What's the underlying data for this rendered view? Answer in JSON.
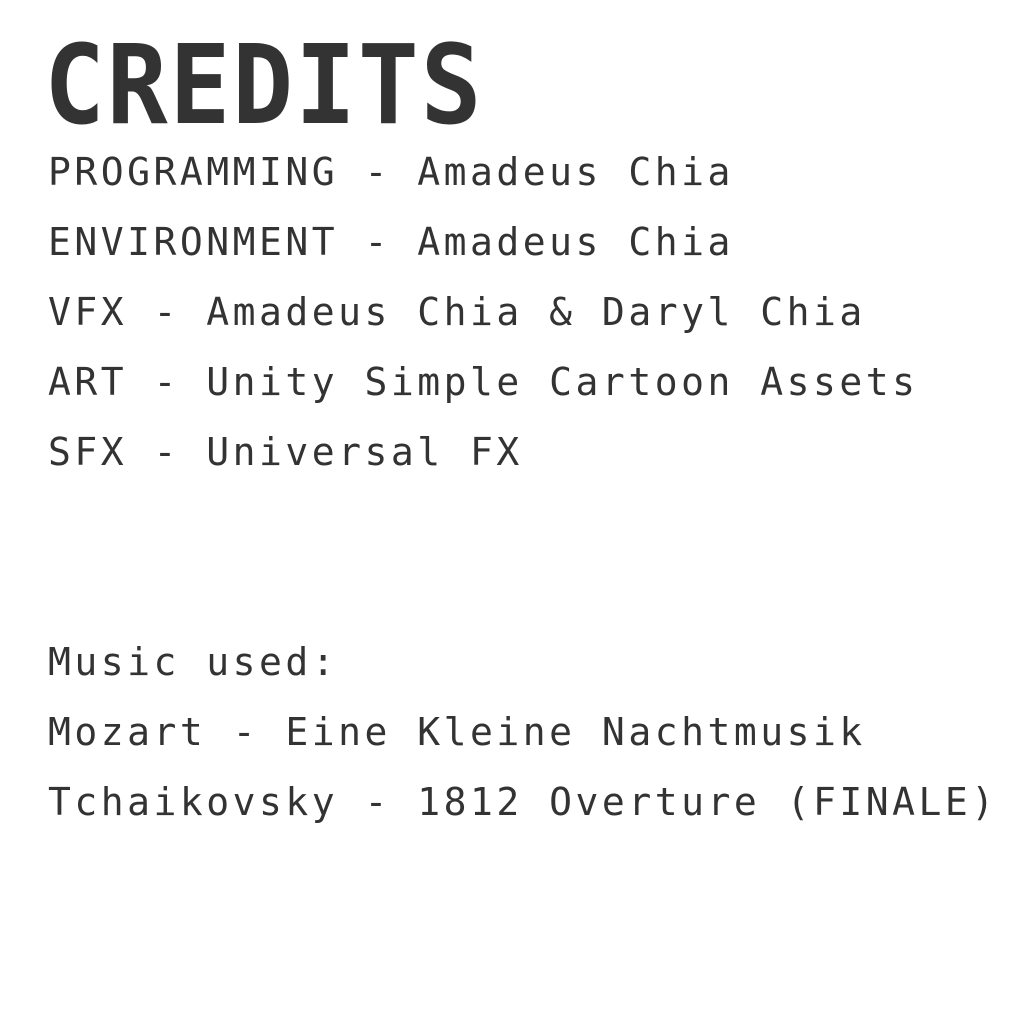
{
  "colors": {
    "background": "#ffffff",
    "text": "#333333"
  },
  "title": "CREDITS",
  "credits": [
    "PROGRAMMING - Amadeus Chia",
    "ENVIRONMENT - Amadeus Chia",
    "VFX - Amadeus Chia & Daryl Chia",
    "ART - Unity Simple Cartoon Assets",
    "SFX - Universal FX"
  ],
  "music": {
    "heading": "Music used:",
    "tracks": [
      "Mozart - Eine Kleine Nachtmusik",
      "Tchaikovsky - 1812 Overture (FINALE)"
    ]
  }
}
